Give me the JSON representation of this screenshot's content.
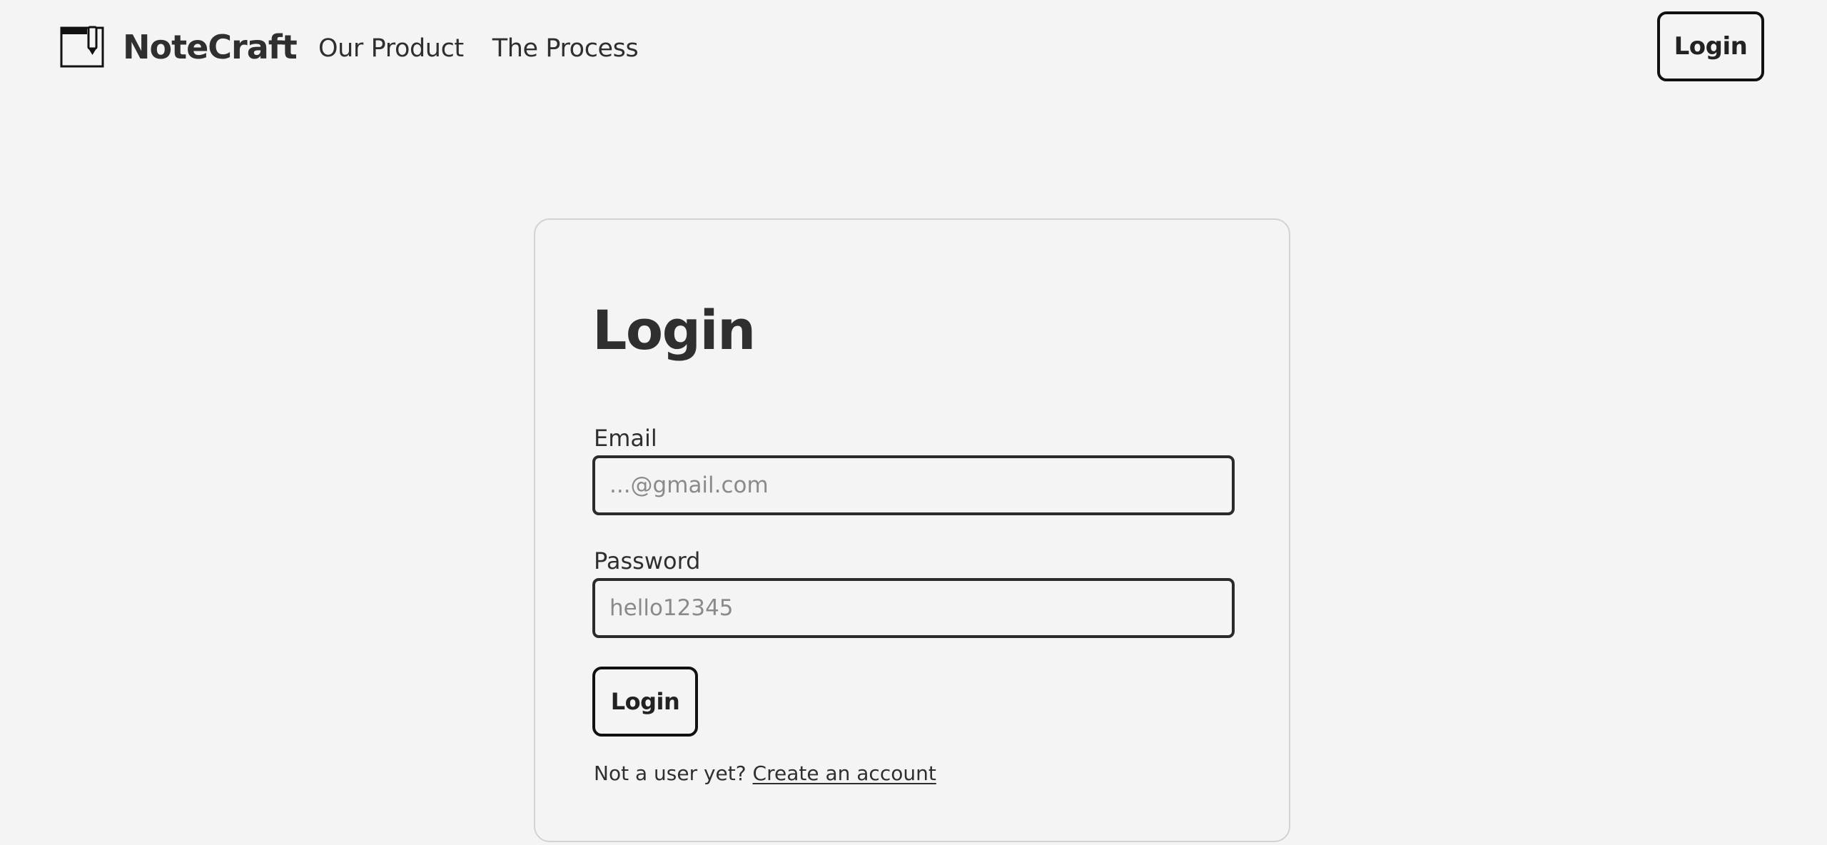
{
  "header": {
    "brand_name": "NoteCraft",
    "brand_icon": "notebook-pencil-icon",
    "nav": [
      {
        "label": "Our Product"
      },
      {
        "label": "The Process"
      }
    ],
    "login_label": "Login"
  },
  "login_form": {
    "title": "Login",
    "email": {
      "label": "Email",
      "value": "",
      "placeholder": "...@gmail.com"
    },
    "password": {
      "label": "Password",
      "value": "",
      "placeholder": "hello12345"
    },
    "submit_label": "Login",
    "signup_prompt": "Not a user yet?",
    "signup_link": "Create an account"
  },
  "colors": {
    "background": "#f4f4f4",
    "text": "#2f2f2f",
    "border_dark": "#111111",
    "card_border": "#d2d2d2",
    "placeholder": "#8a8a8a"
  }
}
